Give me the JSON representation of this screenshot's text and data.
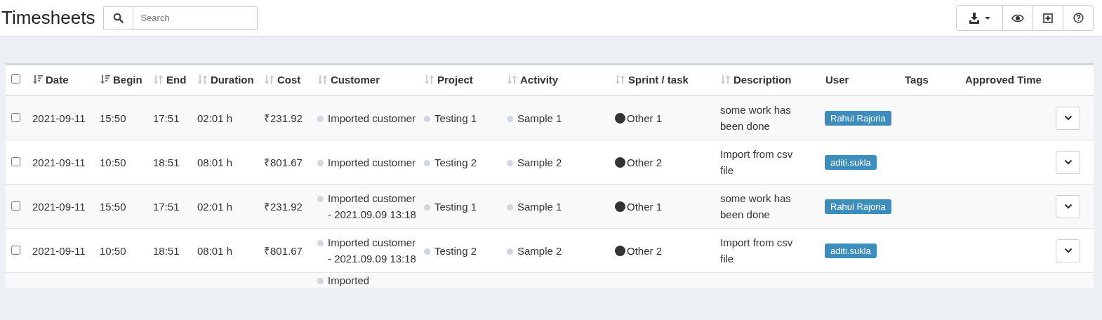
{
  "page": {
    "title": "Timesheets"
  },
  "search": {
    "placeholder": "Search"
  },
  "toolbar": [
    {
      "kind": "download"
    },
    {
      "kind": "view"
    },
    {
      "kind": "add"
    },
    {
      "kind": "help"
    }
  ],
  "table": {
    "select_all": {
      "checked": false
    },
    "columns": [
      {
        "label": "Date",
        "kind": "sortable",
        "sorted": true
      },
      {
        "label": "Begin",
        "kind": "sortable",
        "sorted": true
      },
      {
        "label": "End",
        "kind": "sortable",
        "sorted": false
      },
      {
        "label": "Duration",
        "kind": "sortable",
        "sorted": false
      },
      {
        "label": "Cost",
        "kind": "sortable",
        "sorted": false
      },
      {
        "label": "Customer",
        "kind": "sortable",
        "sorted": false
      },
      {
        "label": "Project",
        "kind": "sortable",
        "sorted": false
      },
      {
        "label": "Activity",
        "kind": "sortable",
        "sorted": false
      },
      {
        "label": "Sprint / task",
        "kind": "sortable",
        "sorted": false
      },
      {
        "label": "Description",
        "kind": "sortable",
        "sorted": false
      },
      {
        "label": "User",
        "kind": "plain"
      },
      {
        "label": "Tags",
        "kind": "plain"
      },
      {
        "label": "Approved Time",
        "kind": "plain"
      }
    ],
    "rows": [
      {
        "checked": false,
        "date": "2021-09-11",
        "begin": "15:50",
        "end": "17:51",
        "duration": "02:01 h",
        "cost": "₹231.92",
        "customer": "Imported customer",
        "project": "Testing 1",
        "activity": "Sample 1",
        "task": "Other 1",
        "description": "some work has been done",
        "user": "Rahul Rajoria"
      },
      {
        "checked": false,
        "date": "2021-09-11",
        "begin": "10:50",
        "end": "18:51",
        "duration": "08:01 h",
        "cost": "₹801.67",
        "customer": "Imported customer",
        "project": "Testing 2",
        "activity": "Sample 2",
        "task": "Other 2",
        "description": "Import from csv file",
        "user": "aditi.sukla"
      },
      {
        "checked": false,
        "date": "2021-09-11",
        "begin": "15:50",
        "end": "17:51",
        "duration": "02:01 h",
        "cost": "₹231.92",
        "customer": "Imported customer - 2021.09.09 13:18",
        "project": "Testing 1",
        "activity": "Sample 1",
        "task": "Other 1",
        "description": "some work has been done",
        "user": "Rahul Rajoria"
      },
      {
        "checked": false,
        "date": "2021-09-11",
        "begin": "10:50",
        "end": "18:51",
        "duration": "08:01 h",
        "cost": "₹801.67",
        "customer": "Imported customer - 2021.09.09 13:18",
        "project": "Testing 2",
        "activity": "Sample 2",
        "task": "Other 2",
        "description": "Import from csv file",
        "user": "aditi.sukla"
      },
      {
        "customer": "Imported"
      }
    ]
  }
}
